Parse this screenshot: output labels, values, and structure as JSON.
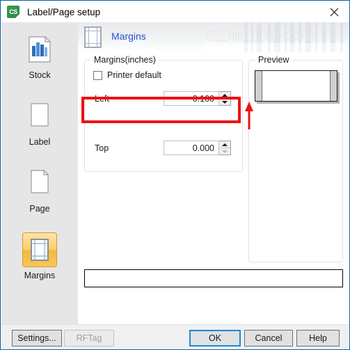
{
  "window": {
    "title": "Label/Page setup",
    "icon": "app-cs-icon",
    "close_label": "✕"
  },
  "sidebar": {
    "items": [
      {
        "label": "Stock",
        "icon": "stock-icon",
        "selected": false
      },
      {
        "label": "Label",
        "icon": "label-icon",
        "selected": false
      },
      {
        "label": "Page",
        "icon": "page-icon",
        "selected": false
      },
      {
        "label": "Margins",
        "icon": "margins-icon",
        "selected": true
      }
    ]
  },
  "header": {
    "title": "Margins",
    "icon": "margins-page-icon",
    "title_color": "#2a4fd0"
  },
  "margins_group": {
    "title": "Margins(inches)",
    "printer_default": {
      "label": "Printer default",
      "checked": false
    },
    "fields": [
      {
        "label": "Left",
        "value": "0.100",
        "up_enabled": true,
        "down_enabled": true,
        "highlighted": true
      },
      {
        "label": "Top",
        "value": "0.000",
        "up_enabled": true,
        "down_enabled": false,
        "highlighted": false
      }
    ]
  },
  "preview_group": {
    "title": "Preview"
  },
  "annotations": {
    "highlight_color": "#ee1111",
    "arrow_color": "#ee1111",
    "arrow_name": "red-up-arrow-pointing-to-left-margin-field"
  },
  "status_bar": {
    "message": ""
  },
  "footer": {
    "buttons": [
      {
        "id": "settings",
        "label": "Settings...",
        "enabled": true,
        "default": false
      },
      {
        "id": "rftag",
        "label": "RFTag",
        "enabled": false,
        "default": false
      },
      {
        "id": "ok",
        "label": "OK",
        "enabled": true,
        "default": true
      },
      {
        "id": "cancel",
        "label": "Cancel",
        "enabled": true,
        "default": false
      },
      {
        "id": "help",
        "label": "Help",
        "enabled": true,
        "default": false
      }
    ]
  }
}
